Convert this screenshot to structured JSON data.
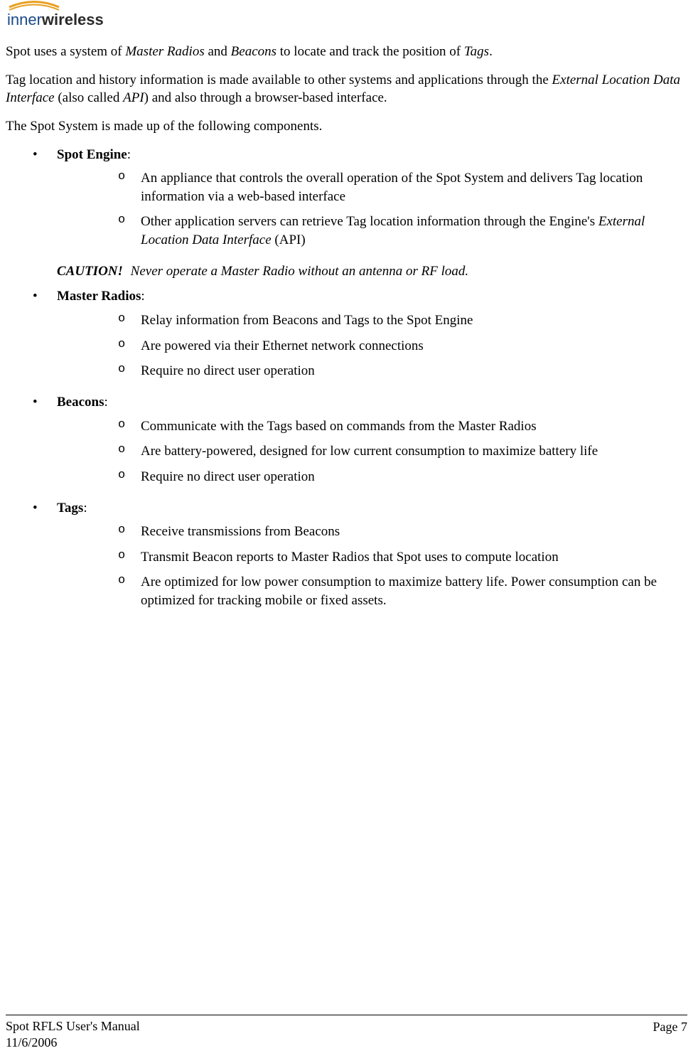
{
  "logo": {
    "brand_name": "innerwireless",
    "brand_prefix": "inner",
    "brand_suffix": "wireless",
    "prefix_color": "#1a4a8a",
    "suffix_color": "#2a2a2a",
    "swoosh_color": "#e8a020"
  },
  "intro": {
    "p1_parts": [
      {
        "t": "Spot uses a system of ",
        "i": false
      },
      {
        "t": "Master Radios",
        "i": true
      },
      {
        "t": " and ",
        "i": false
      },
      {
        "t": "Beacons",
        "i": true
      },
      {
        "t": " to locate and track the position of ",
        "i": false
      },
      {
        "t": "Tags",
        "i": true
      },
      {
        "t": ".",
        "i": false
      }
    ],
    "p2_parts": [
      {
        "t": "Tag location and history information is made available to other systems and applications through the ",
        "i": false
      },
      {
        "t": "External Location Data Interface",
        "i": true
      },
      {
        "t": " (also called ",
        "i": false
      },
      {
        "t": "API",
        "i": true
      },
      {
        "t": ") and also through a browser-based interface.",
        "i": false
      }
    ],
    "p3": "The Spot System is made up of the following components."
  },
  "components": [
    {
      "title": "Spot Engine",
      "items": [
        "An appliance that controls the overall operation of the Spot System and delivers Tag location information via a web-based interface",
        "Other application servers can retrieve Tag location information through the Engine's <i>External Location Data Interface</i> (API)"
      ]
    },
    {
      "title": "Master Radios",
      "items": [
        "Relay information from Beacons and Tags to the Spot Engine",
        "Are powered via their Ethernet network connections",
        "Require no direct user operation"
      ]
    },
    {
      "title": "Beacons",
      "items": [
        "Communicate with the Tags based on commands from the Master Radios",
        "Are battery-powered, designed for low current consumption to maximize battery life",
        "Require no direct user operation"
      ]
    },
    {
      "title": "Tags",
      "items": [
        "Receive transmissions from Beacons",
        "Transmit Beacon reports to Master Radios that Spot uses to compute location",
        "Are optimized for low power consumption to maximize battery life. Power consumption can be optimized for tracking mobile or fixed assets."
      ]
    }
  ],
  "caution": {
    "label": "CAUTION!",
    "text": "Never operate a Master Radio without an antenna or RF load.",
    "after_index": 0
  },
  "footer": {
    "title": "Spot RFLS User's Manual",
    "date": "11/6/2006",
    "page": "Page 7"
  }
}
